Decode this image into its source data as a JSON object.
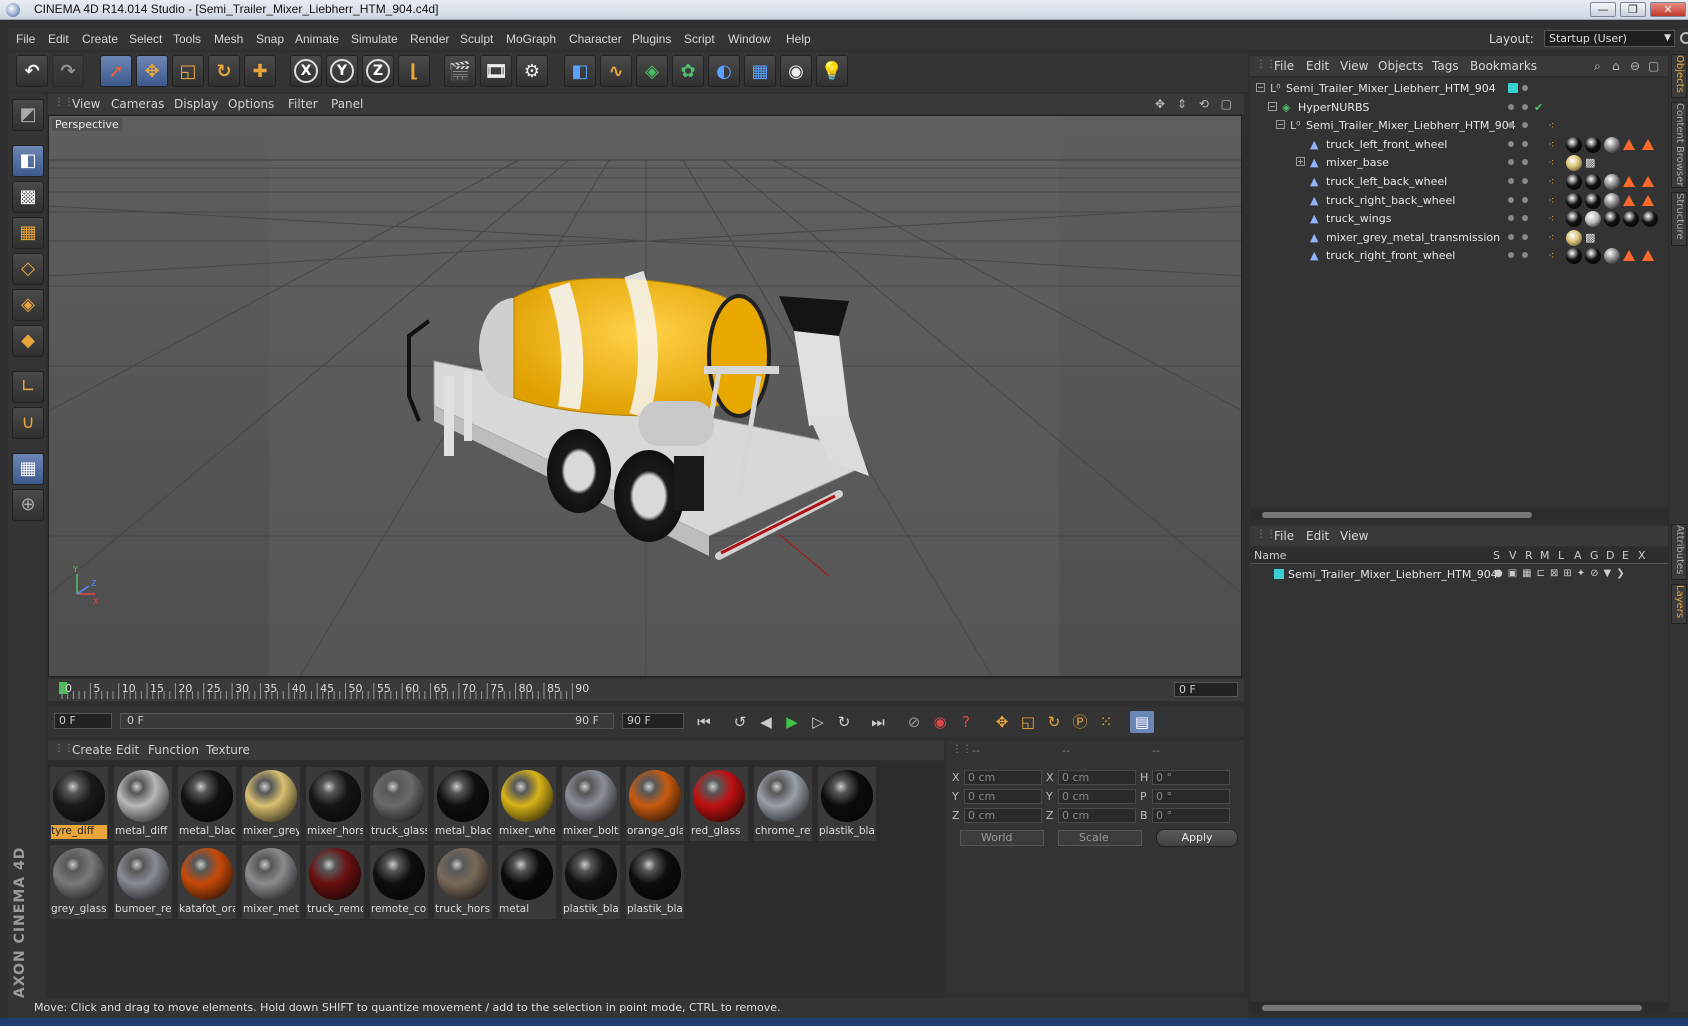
{
  "window": {
    "title": "CINEMA 4D R14.014 Studio - [Semi_Trailer_Mixer_Liebherr_HTM_904.c4d]",
    "controls": [
      "—",
      "❐",
      "✕"
    ]
  },
  "menubar": {
    "items": [
      "File",
      "Edit",
      "Create",
      "Select",
      "Tools",
      "Mesh",
      "Snap",
      "Animate",
      "Simulate",
      "Render",
      "Sculpt",
      "MoGraph",
      "Character",
      "Plugins",
      "Script",
      "Window",
      "Help"
    ],
    "layout_label": "Layout:",
    "layout_value": "Startup (User)"
  },
  "toolbar": {
    "xyz": [
      "X",
      "Y",
      "Z"
    ]
  },
  "viewport": {
    "menu": [
      "View",
      "Cameras",
      "Display",
      "Options",
      "Filter",
      "Panel"
    ],
    "label": "Perspective",
    "nav_icons": "✥ ⇕ ⟲ ▢"
  },
  "timeline": {
    "ticks": [
      "0",
      "5",
      "10",
      "15",
      "20",
      "25",
      "30",
      "35",
      "40",
      "45",
      "50",
      "55",
      "60",
      "65",
      "70",
      "75",
      "80",
      "85",
      "90"
    ],
    "current_frame": "0 F",
    "start_field": "0 F",
    "range_start": "0 F",
    "range_end": "90 F",
    "end_field": "90 F"
  },
  "materials": {
    "menu": [
      "Create",
      "Edit",
      "Function",
      "Texture"
    ],
    "items": [
      {
        "label": "tyre_diff",
        "color": "#1a1a1a"
      },
      {
        "label": "metal_diff",
        "color": "#b8b8b8"
      },
      {
        "label": "metal_blacl",
        "color": "#111111"
      },
      {
        "label": "mixer_grey_",
        "color": "#d8c070"
      },
      {
        "label": "mixer_hors",
        "color": "#151515"
      },
      {
        "label": "truck_glass",
        "color": "#6a6a6a"
      },
      {
        "label": "metal_blacl",
        "color": "#0e0e0e"
      },
      {
        "label": "mixer_whe",
        "color": "#d8b418"
      },
      {
        "label": "mixer_bolts",
        "color": "#8a8e96"
      },
      {
        "label": "orange_gla",
        "color": "#c85a10"
      },
      {
        "label": "red_glass",
        "color": "#c01010"
      },
      {
        "label": "chrome_ref",
        "color": "#9aa0a8"
      },
      {
        "label": "plastik_bla",
        "color": "#0c0c0c"
      },
      {
        "label": "grey_glass",
        "color": "#7a7a7a"
      },
      {
        "label": "bumoer_re",
        "color": "#888c94"
      },
      {
        "label": "katafot_ora",
        "color": "#c84a08"
      },
      {
        "label": "mixer_meta",
        "color": "#8a8c90"
      },
      {
        "label": "truck_remo",
        "color": "#6a1010"
      },
      {
        "label": "remote_cor",
        "color": "#0e0e0e"
      },
      {
        "label": "truck_hors",
        "color": "#7a6a5a"
      },
      {
        "label": "metal",
        "color": "#0a0a0a"
      },
      {
        "label": "plastik_bla",
        "color": "#111111"
      },
      {
        "label": "plastik_bla",
        "color": "#0c0c0c"
      }
    ]
  },
  "coords": {
    "headers": [
      "--",
      "--",
      "--"
    ],
    "rows": [
      {
        "a": "X",
        "av": "0 cm",
        "b": "X",
        "bv": "0 cm",
        "c": "H",
        "cv": "0 °"
      },
      {
        "a": "Y",
        "av": "0 cm",
        "b": "Y",
        "bv": "0 cm",
        "c": "P",
        "cv": "0 °"
      },
      {
        "a": "Z",
        "av": "0 cm",
        "b": "Z",
        "bv": "0 cm",
        "c": "B",
        "cv": "0 °"
      }
    ],
    "space": "World",
    "mode": "Scale",
    "apply": "Apply"
  },
  "status": {
    "message": "Move: Click and drag to move elements. Hold down SHIFT to quantize movement / add to the selection in point mode, CTRL to remove."
  },
  "objects": {
    "menu": [
      "File",
      "Edit",
      "View",
      "Objects",
      "Tags",
      "Bookmarks"
    ],
    "rows": [
      {
        "name": "Semi_Trailer_Mixer_Liebherr_HTM_904"
      },
      {
        "name": "HyperNURBS"
      },
      {
        "name": "Semi_Trailer_Mixer_Liebherr_HTM_904"
      },
      {
        "name": "truck_left_front_wheel"
      },
      {
        "name": "mixer_base"
      },
      {
        "name": "truck_left_back_wheel"
      },
      {
        "name": "truck_right_back_wheel"
      },
      {
        "name": "truck_wings"
      },
      {
        "name": "mixer_grey_metal_transmission"
      },
      {
        "name": "truck_right_front_wheel"
      }
    ]
  },
  "layers": {
    "menu": [
      "File",
      "Edit",
      "View"
    ],
    "columns": [
      "Name",
      "S",
      "V",
      "R",
      "M",
      "L",
      "A",
      "G",
      "D",
      "E",
      "X"
    ],
    "rows": [
      {
        "name": "Semi_Trailer_Mixer_Liebherr_HTM_904",
        "color": "#3ad0d8"
      }
    ]
  },
  "side_tabs": [
    "Objects",
    "Content Browser",
    "Structure",
    "Attributes",
    "Layers"
  ],
  "branding": "MAXON CINEMA 4D"
}
